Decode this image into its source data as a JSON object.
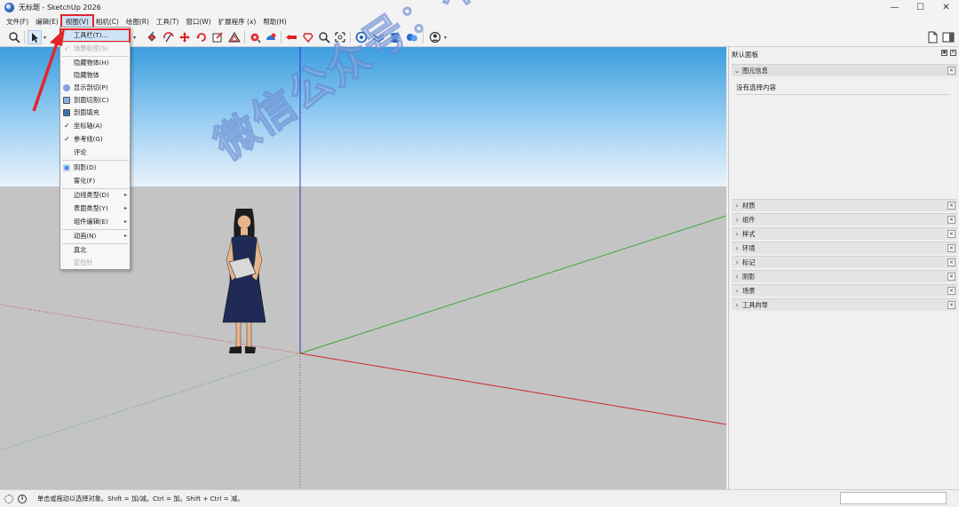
{
  "window": {
    "title": "无标题 - SketchUp 2026",
    "controls": [
      "—",
      "☐",
      "✕"
    ]
  },
  "menubar": {
    "items": [
      "文件(F)",
      "编辑(E)",
      "视图(V)",
      "相机(C)",
      "绘图(R)",
      "工具(T)",
      "窗口(W)",
      "扩展程序 (x)",
      "帮助(H)"
    ],
    "active_index": 2
  },
  "view_menu": {
    "items": [
      {
        "label": "工具栏(T)...",
        "highlight": true
      },
      {
        "label": "场景标签(S)",
        "check": "✓",
        "disabled": true
      },
      {
        "label": "隐藏物体(H)"
      },
      {
        "label": "隐藏物体"
      },
      {
        "label": "显示剖切(P)",
        "icon": "section-plane-icon"
      },
      {
        "label": "剖面切割(C)",
        "icon": "section-cut-icon"
      },
      {
        "label": "剖面填充",
        "icon": "section-fill-icon"
      },
      {
        "label": "坐标轴(A)",
        "check": "✓"
      },
      {
        "label": "参考线(G)",
        "check": "✓"
      },
      {
        "label": "评论"
      },
      {
        "label": "阴影(D)",
        "icon": "shadow-icon"
      },
      {
        "label": "雾化(F)"
      },
      {
        "label": "边线类型(D)",
        "submenu": "▸"
      },
      {
        "label": "表面类型(Y)",
        "submenu": "▸"
      },
      {
        "label": "组件编辑(E)",
        "submenu": "▸"
      },
      {
        "label": "动画(N)",
        "submenu": "▸"
      },
      {
        "label": "真北"
      },
      {
        "label": "定位针",
        "disabled": true
      }
    ]
  },
  "toolbar": {
    "icons": [
      "zoom-icon",
      "select-icon",
      "paint-bucket-icon",
      "orbit-icon",
      "push-pull-icon",
      "move-icon",
      "rotate-icon",
      "scale-icon",
      "offset-icon",
      "tape-measure-icon",
      "protractor-icon",
      "text-icon",
      "position-camera-icon",
      "walk-icon",
      "look-around-icon",
      "zoom-extents-icon",
      "3d-warehouse-icon",
      "extension-warehouse-icon",
      "layout-icon",
      "messages-icon",
      "account-icon"
    ],
    "right_icon": "new-file-icon"
  },
  "panel": {
    "title": "默认面板",
    "entity_info": {
      "label": "图元信息",
      "message": "没有选择内容"
    },
    "trays": [
      "材质",
      "组件",
      "样式",
      "环境",
      "标记",
      "阴影",
      "场景",
      "工具向导"
    ]
  },
  "statusbar": {
    "hint": "单击或拖动以选择对象。Shift = 加/减。Ctrl = 加。Shift + Ctrl = 减。",
    "info_icon": "i"
  },
  "watermark": "微信公众号：不迷路资源库",
  "colors": {
    "sky_top": "#3b9ee0",
    "sky_bottom": "#e9f3fb",
    "ground": "#c4c4c4",
    "axis_red": "#cc2a2a",
    "axis_green": "#39a839",
    "axis_blue": "#3232c8",
    "highlight_outline": "#e1262c"
  }
}
